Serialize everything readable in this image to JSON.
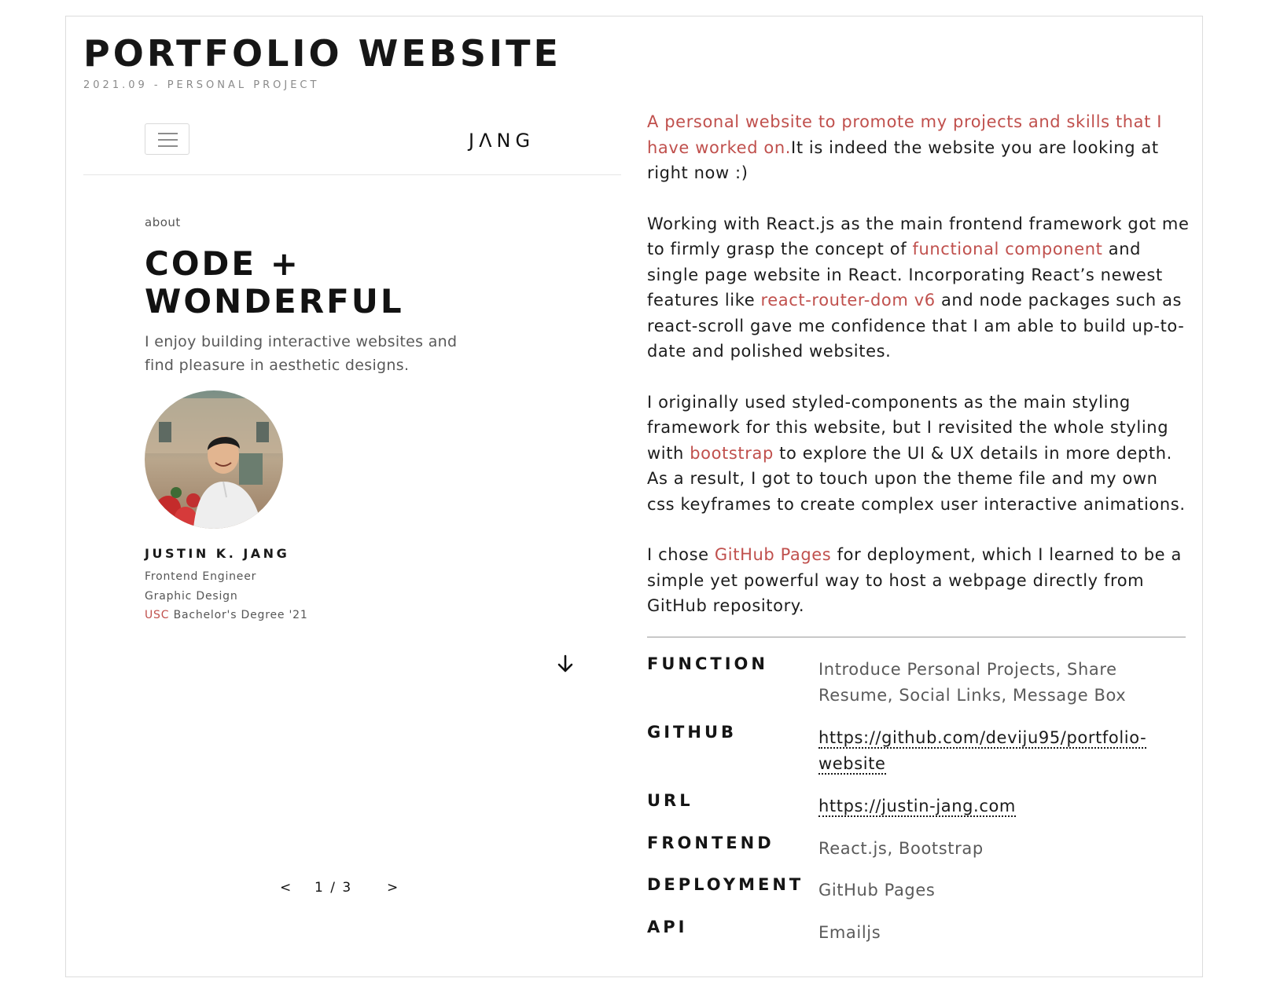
{
  "project": {
    "title": "PORTFOLIO WEBSITE",
    "subtitle": "2021.09 - PERSONAL PROJECT"
  },
  "preview": {
    "brand": "JΛNG",
    "menu_icon": "hamburger-menu-icon",
    "about_label": "about",
    "headline_line1": "CODE +",
    "headline_line2": "WONDERFUL",
    "tagline": "I enjoy building interactive websites and find pleasure in aesthetic designs.",
    "name": "JUSTIN K. JANG",
    "role1": "Frontend Engineer",
    "role2": "Graphic Design",
    "school": "USC",
    "degree": " Bachelor's Degree '21",
    "down_icon": "arrow-down-icon",
    "pager": {
      "prev": "<",
      "count": "1 / 3",
      "next": ">"
    }
  },
  "description": {
    "p1_highlight": "A personal website to promote my projects and skills that I have worked on.",
    "p1_rest": "It is indeed the website you are looking at right now :)",
    "p2_a": "Working with React.js as the main frontend framework got me to firmly grasp the concept of ",
    "p2_link1": "functional component",
    "p2_b": " and single page website in React. Incorporating React’s newest features like ",
    "p2_link2": "react-router-dom v6",
    "p2_c": " and node packages such as react-scroll gave me confidence that I am able to build up-to-date and polished websites.",
    "p3_a": "I originally used styled-components as the main styling framework for this website, but I revisited the whole styling with ",
    "p3_link": "bootstrap",
    "p3_b": " to explore the UI & UX details in more depth. As a result, I got to touch upon the theme file and my own css keyframes to create complex user interactive animations.",
    "p4_a": "I chose ",
    "p4_link": "GitHub Pages",
    "p4_b": " for deployment, which I learned to be a simple yet powerful way to host a webpage directly from GitHub repository."
  },
  "specs": {
    "function": {
      "key": "FUNCTION",
      "value": "Introduce Personal Projects, Share Resume, Social Links, Message Box"
    },
    "github": {
      "key": "GITHUB",
      "value": "https://github.com/deviju95/portfolio-website"
    },
    "url": {
      "key": "URL",
      "value": "https://justin-jang.com"
    },
    "frontend": {
      "key": "FRONTEND",
      "value": "React.js, Bootstrap"
    },
    "deployment": {
      "key": "DEPLOYMENT",
      "value": "GitHub Pages"
    },
    "api": {
      "key": "API",
      "value": "Emailjs"
    }
  },
  "colors": {
    "accent": "#c0504d",
    "text": "#1c1c1c",
    "muted": "#5a5a5a",
    "border": "#dcdcdc"
  }
}
